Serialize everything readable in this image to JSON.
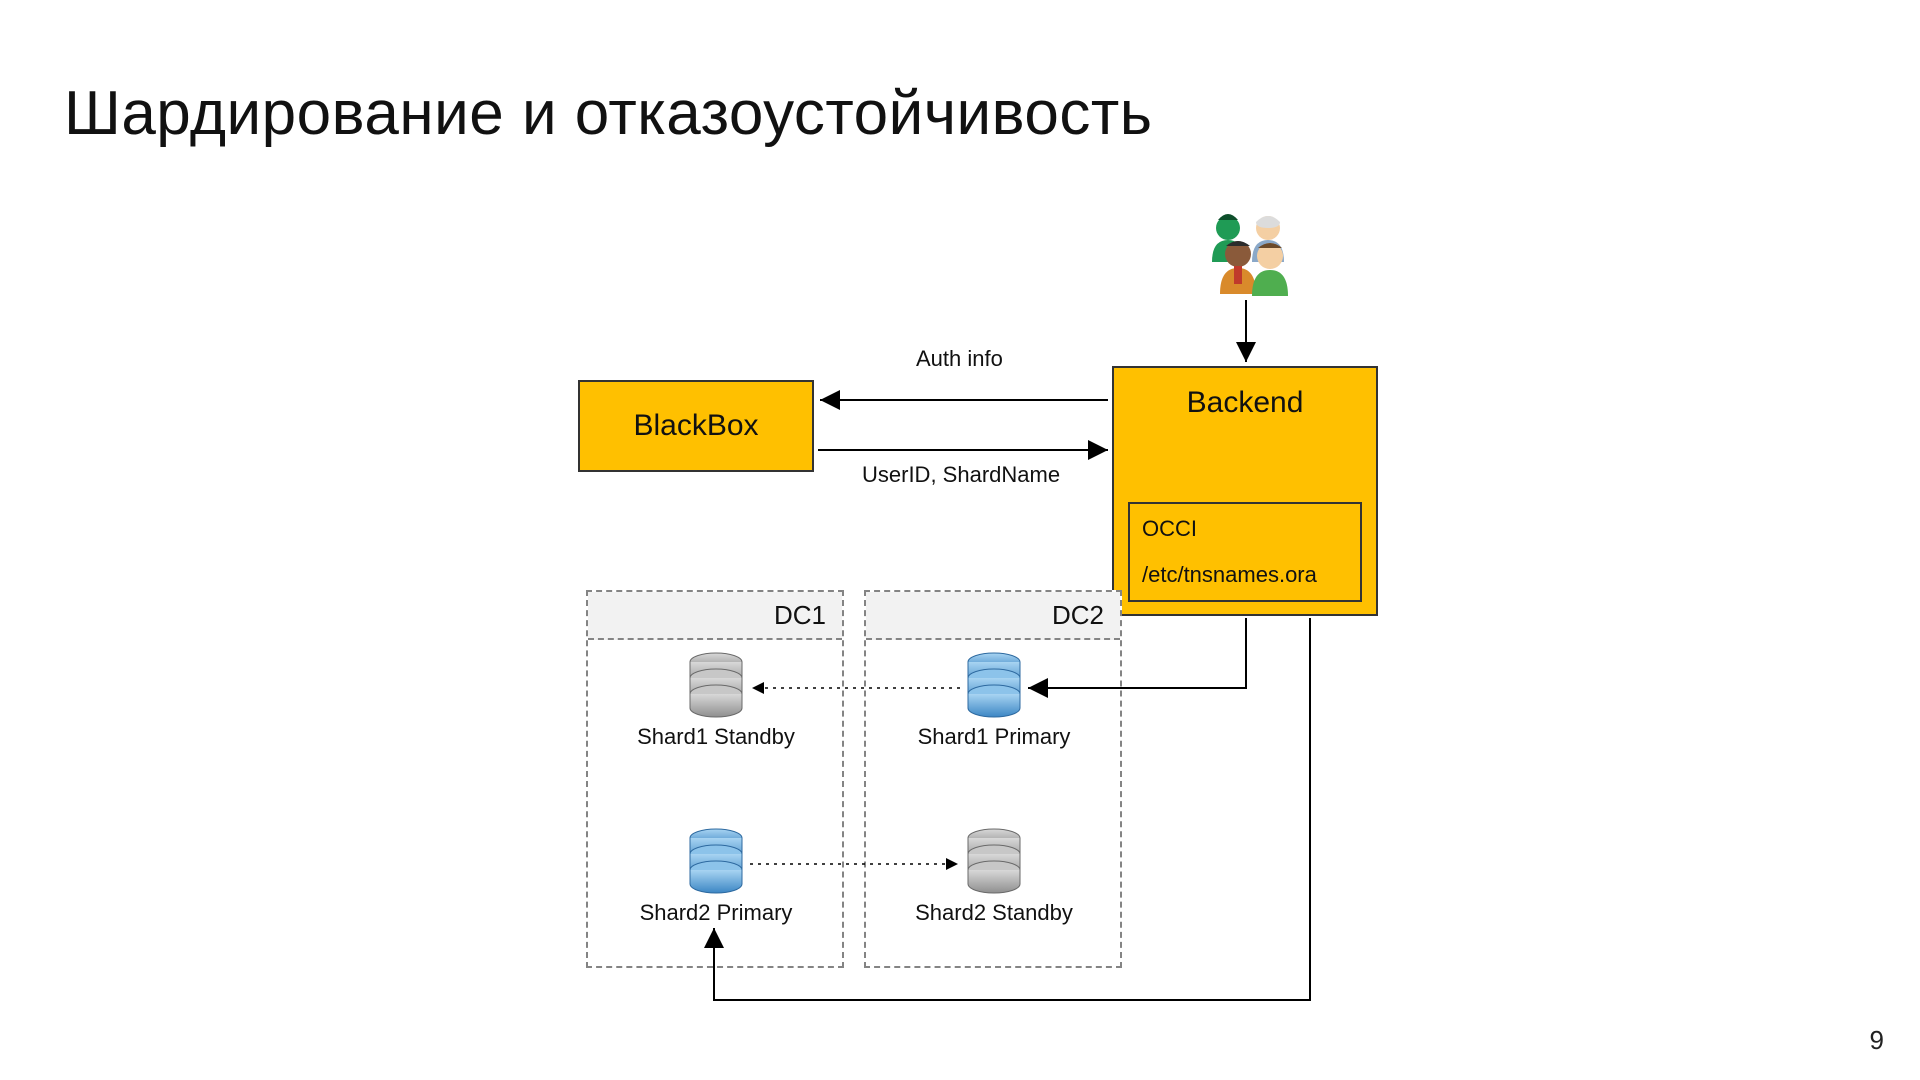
{
  "title": "Шардирование и отказоустойчивость",
  "page_number": "9",
  "nodes": {
    "blackbox": {
      "label": "BlackBox"
    },
    "backend": {
      "label": "Backend",
      "occi": {
        "line1": "OCCI",
        "line2": "/etc/tnsnames.ora"
      }
    },
    "users": {
      "icon": "users-group"
    },
    "dc1": {
      "header": "DC1",
      "shard1": {
        "label": "Shard1 Standby",
        "role": "standby"
      },
      "shard2": {
        "label": "Shard2 Primary",
        "role": "primary"
      }
    },
    "dc2": {
      "header": "DC2",
      "shard1": {
        "label": "Shard1 Primary",
        "role": "primary"
      },
      "shard2": {
        "label": "Shard2 Standby",
        "role": "standby"
      }
    }
  },
  "edges": {
    "auth_info": {
      "label": "Auth info",
      "from": "backend",
      "to": "blackbox",
      "style": "solid"
    },
    "userid_shardname": {
      "label": "UserID, ShardName",
      "from": "blackbox",
      "to": "backend",
      "style": "solid"
    },
    "users_to_backend": {
      "from": "users",
      "to": "backend",
      "style": "solid"
    },
    "backend_to_shard1_primary": {
      "from": "backend",
      "to": "dc2.shard1",
      "style": "solid"
    },
    "backend_to_shard2_primary": {
      "from": "backend",
      "to": "dc1.shard2",
      "style": "solid"
    },
    "shard1_primary_to_standby": {
      "from": "dc2.shard1",
      "to": "dc1.shard1",
      "style": "dotted"
    },
    "shard2_primary_to_standby": {
      "from": "dc1.shard2",
      "to": "dc2.shard2",
      "style": "dotted"
    }
  },
  "colors": {
    "accent": "#ffc000",
    "primary_db": "#4ea3e0",
    "standby_db": "#9a9a9a",
    "border": "#333333",
    "dash": "#848484"
  }
}
